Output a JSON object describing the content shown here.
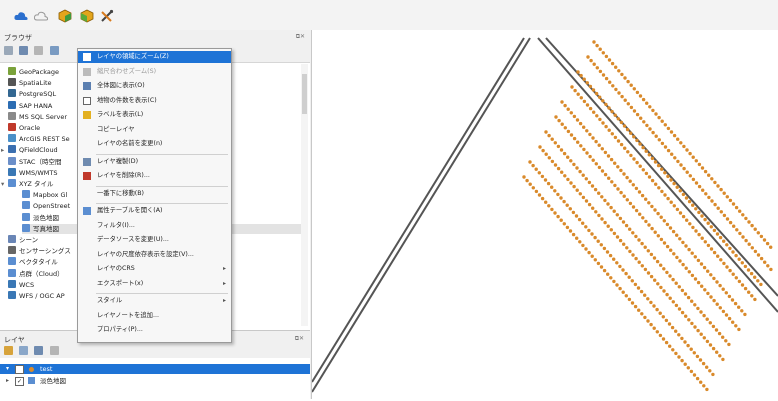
{
  "browser_panel": {
    "title": "ブラウザ",
    "items": [
      {
        "label": "GeoPackage",
        "icon": "geopackage-icon",
        "color": "#7aa23a"
      },
      {
        "label": "SpatiaLite",
        "icon": "spatialite-icon",
        "color": "#555555"
      },
      {
        "label": "PostgreSQL",
        "icon": "postgresql-icon",
        "color": "#336791"
      },
      {
        "label": "SAP HANA",
        "icon": "sap-hana-icon",
        "color": "#2c6db3"
      },
      {
        "label": "MS SQL Server",
        "icon": "mssql-icon",
        "color": "#8a8a8a"
      },
      {
        "label": "Oracle",
        "icon": "oracle-icon",
        "color": "#c0392b"
      },
      {
        "label": "ArcGIS REST Se",
        "icon": "arcgis-icon",
        "color": "#4a90c8"
      },
      {
        "label": "QFieldCloud",
        "icon": "cloud-icon",
        "color": "#3a6fb0"
      },
      {
        "label": "STAC（時空間",
        "icon": "stac-icon",
        "color": "#6b8fc9"
      },
      {
        "label": "WMS/WMTS",
        "icon": "wms-icon",
        "color": "#3a78b5"
      },
      {
        "label": "XYZ タイル",
        "icon": "xyz-tiles-icon",
        "color": "#5b8ed1"
      },
      {
        "label": "Mapbox Gl",
        "icon": "tile-icon",
        "color": "#5b8ed1"
      },
      {
        "label": "OpenStreet",
        "icon": "tile-icon",
        "color": "#5b8ed1"
      },
      {
        "label": "淡色地図",
        "icon": "tile-icon",
        "color": "#5b8ed1"
      },
      {
        "label": "写真地図",
        "icon": "tile-icon",
        "color": "#5b8ed1"
      },
      {
        "label": "シーン",
        "icon": "scene-icon",
        "color": "#6a86b6"
      },
      {
        "label": "センサーシングス",
        "icon": "sensor-icon",
        "color": "#666666"
      },
      {
        "label": "ベクタタイル",
        "icon": "vector-tile-icon",
        "color": "#5b8ed1"
      },
      {
        "label": "点群（Cloud）",
        "icon": "point-cloud-icon",
        "color": "#5b8ed1"
      },
      {
        "label": "WCS",
        "icon": "wcs-icon",
        "color": "#3a78b5"
      },
      {
        "label": "WFS / OGC AP",
        "icon": "wfs-icon",
        "color": "#3a78b5"
      }
    ]
  },
  "layers_panel": {
    "title": "レイヤ",
    "layers": [
      {
        "label": "test",
        "checked": "✓"
      },
      {
        "label": "淡色地図",
        "checked": "✓"
      }
    ]
  },
  "context_menu": {
    "items": [
      {
        "label": "レイヤの領域にズーム(Z)",
        "icon": "zoom-layer-icon",
        "selected": true,
        "disabled": false
      },
      {
        "label": "縮尺合わせズーム(S)",
        "icon": "zoom-scale-icon",
        "selected": false,
        "disabled": true
      },
      {
        "label": "全体図に表示(O)",
        "icon": "overview-icon",
        "selected": false,
        "disabled": false
      },
      {
        "label": "地物の件数を表示(C)",
        "icon": "feature-count-icon",
        "selected": false,
        "disabled": false
      },
      {
        "label": "ラベルを表示(L)",
        "icon": "label-icon",
        "selected": false,
        "disabled": false
      },
      {
        "label": "コピーレイヤ",
        "icon": "",
        "selected": false,
        "disabled": false
      },
      {
        "label": "レイヤの名前を変更(n)",
        "icon": "",
        "selected": false,
        "disabled": false
      },
      {
        "label": "レイヤ複製(D)",
        "icon": "duplicate-layer-icon",
        "selected": false,
        "disabled": false
      },
      {
        "label": "レイヤを削除(R)...",
        "icon": "remove-layer-icon",
        "selected": false,
        "disabled": false
      },
      {
        "label": "一番下に移動(B)",
        "icon": "",
        "selected": false,
        "disabled": false
      },
      {
        "label": "属性テーブルを開く(A)",
        "icon": "attribute-table-icon",
        "selected": false,
        "disabled": false
      },
      {
        "label": "フィルタ(I)...",
        "icon": "",
        "selected": false,
        "disabled": false
      },
      {
        "label": "データソースを変更(U)...",
        "icon": "",
        "selected": false,
        "disabled": false
      },
      {
        "label": "レイヤの尺度依存表示を設定(V)...",
        "icon": "",
        "selected": false,
        "disabled": false
      },
      {
        "label": "レイヤのCRS",
        "icon": "",
        "selected": false,
        "disabled": false,
        "submenu": "▸"
      },
      {
        "label": "エクスポート(x)",
        "icon": "",
        "selected": false,
        "disabled": false,
        "submenu": "▸"
      },
      {
        "label": "スタイル",
        "icon": "",
        "selected": false,
        "disabled": false,
        "submenu": "▸"
      },
      {
        "label": "レイヤノートを追加...",
        "icon": "",
        "selected": false,
        "disabled": false
      },
      {
        "label": "プロパティ(P)...",
        "icon": "",
        "selected": false,
        "disabled": false
      }
    ]
  },
  "colors": {
    "selection": "#1e73d6",
    "points": "#d98a2b",
    "road": "#555555"
  }
}
